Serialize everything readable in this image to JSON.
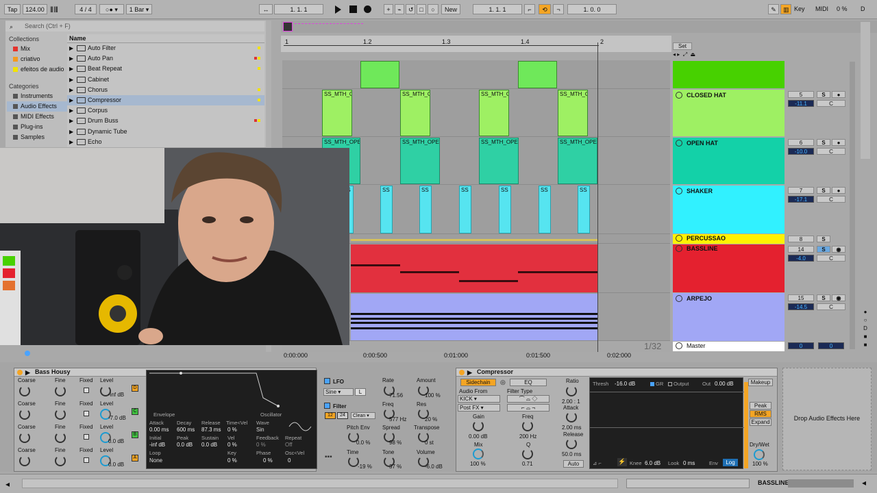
{
  "topbar": {
    "tap": "Tap",
    "tempo": "124.00",
    "sig_num": "4",
    "sig_den": "4",
    "quant": "1 Bar",
    "pos": "1.   1.   1",
    "new": "New",
    "loop_start": "1.   1.   1",
    "loop_len": "1.   0.   0",
    "key": "Key",
    "midi": "MIDI",
    "cpu": "0 %",
    "d": "D"
  },
  "browser": {
    "search_placeholder": "Search (Ctrl + F)",
    "collections_title": "Collections",
    "collections": [
      {
        "label": "Mix",
        "color": "#e4332c"
      },
      {
        "label": "criativo",
        "color": "#f39b1f"
      },
      {
        "label": "efeitos de audio",
        "color": "#f2e200"
      }
    ],
    "categories_title": "Categories",
    "categories": [
      "Instruments",
      "Audio Effects",
      "MIDI Effects",
      "Plug-ins",
      "Samples"
    ],
    "name_header": "Name",
    "files": [
      "Auto Filter",
      "Auto Pan",
      "Beat Repeat",
      "Cabinet",
      "Chorus",
      "Compressor",
      "Corpus",
      "Drum Buss",
      "Dynamic Tube",
      "Echo"
    ]
  },
  "arrangement": {
    "ruler": [
      "1",
      "1.2",
      "1.3",
      "1.4",
      "2"
    ],
    "set": "Set",
    "time_ruler": [
      "0:00:000",
      "0:00:500",
      "0:01:000",
      "0:01:500",
      "0:02:000"
    ],
    "grid": "1/32",
    "clip_a": "SS_MTH_C",
    "clip_b": "SS_MTH_OPE",
    "clip_c": "SS"
  },
  "tracks": [
    {
      "name": "",
      "color": "#47d100",
      "num": "",
      "vol": ""
    },
    {
      "name": "CLOSED HAT",
      "color": "#9ef063",
      "num": "5",
      "vol": "-11.1"
    },
    {
      "name": "OPEN HAT",
      "color": "#13d1a8",
      "num": "6",
      "vol": "-10.0"
    },
    {
      "name": "SHAKER",
      "color": "#31f1ff",
      "num": "7",
      "vol": "-17.1"
    },
    {
      "name": "PERCUSSAO",
      "color": "#fff200",
      "num": "8",
      "vol": ""
    },
    {
      "name": "BASSLINE",
      "color": "#e4212f",
      "num": "14",
      "vol": "-4.0"
    },
    {
      "name": "ARPEJO",
      "color": "#a1a7f5",
      "num": "15",
      "vol": "-14.5"
    },
    {
      "name": "Master",
      "color": "#ffffff",
      "num": "0",
      "vol": "0"
    }
  ],
  "mixer": {
    "s": "S",
    "c": "C"
  },
  "bass": {
    "title": "Bass Housy",
    "rows": [
      {
        "coarse": "Coarse",
        "fine": "Fine",
        "fixed": "Fixed",
        "level": "Level",
        "val": "-inf dB",
        "tag": "D"
      },
      {
        "coarse": "Coarse",
        "fine": "Fine",
        "fixed": "Fixed",
        "level": "Level",
        "val": "-7.0 dB",
        "tag": "C"
      },
      {
        "coarse": "Coarse",
        "fine": "Fine",
        "fixed": "Fixed",
        "level": "Level",
        "val": "0.0 dB",
        "tag": "B"
      },
      {
        "coarse": "Coarse",
        "fine": "Fine",
        "fixed": "Fixed",
        "level": "Level",
        "val": "0.0 dB",
        "tag": "A"
      }
    ]
  },
  "envelope": {
    "envelope": "Envelope",
    "oscillator": "Oscillator",
    "attack": "Attack",
    "decay": "Decay",
    "release": "Release",
    "timevel": "Time<Vel",
    "wave": "Wave",
    "attack_v": "0.00 ms",
    "decay_v": "600 ms",
    "release_v": "87.3 ms",
    "timevel_v": "0 %",
    "wave_v": "Sin",
    "initial": "Initial",
    "peak": "Peak",
    "sustain": "Sustain",
    "vel": "Vel",
    "feedback": "Feedback",
    "repeat": "Repeat",
    "initial_v": "-inf dB",
    "peak_v": "0.0 dB",
    "sustain_v": "0.0 dB",
    "vel_v": "0 %",
    "feedback_v": "0 %",
    "repeat_v": "Off",
    "loop": "Loop",
    "key": "Key",
    "phase": "Phase",
    "oscvel": "Osc<Vel",
    "loop_v": "None",
    "key_v": "0 %",
    "phase_v": "0 %",
    "oscvel_v": "0"
  },
  "lfo": {
    "lfo": "LFO",
    "wave": "Sine",
    "l": "L",
    "rate": "Rate",
    "rate_v": "71.56",
    "amount": "Amount",
    "amount_v": "100 %",
    "filter": "Filter",
    "mode": "Clean",
    "f12": "12",
    "f24": "24",
    "freq": "Freq",
    "freq_v": "577 Hz",
    "res": "Res",
    "res_v": "20 %",
    "pitchenv": "Pitch Env",
    "pitchenv_v": "0.0 %",
    "spread": "Spread",
    "spread_v": "98 %",
    "transpose": "Transpose",
    "transpose_v": "0 st",
    "time": "Time",
    "time_v": "-19 %",
    "tone": "Tone",
    "tone_v": "37 %",
    "volume": "Volume",
    "volume_v": "-6.0 dB"
  },
  "compressor": {
    "title": "Compressor",
    "sidechain": "Sidechain",
    "eq": "EQ",
    "audio_from": "Audio From",
    "source": "KICK",
    "post": "Post FX",
    "filter_type": "Filter Type",
    "gain": "Gain",
    "gain_v": "0.00 dB",
    "mix": "Mix",
    "mix_v": "100 %",
    "freq": "Freq",
    "freq_v": "200 Hz",
    "q": "Q",
    "q_v": "0.71",
    "ratio": "Ratio",
    "ratio_v": "2.00 : 1",
    "attack": "Attack",
    "attack_v": "2.00 ms",
    "release": "Release",
    "release_v": "50.0 ms",
    "auto": "Auto",
    "thresh": "Thresh",
    "thresh_v": "-16.0 dB",
    "gr": "GR",
    "output": "Output",
    "out": "Out",
    "out_v": "0.00 dB",
    "makeup": "Makeup",
    "peak": "Peak",
    "rms": "RMS",
    "expand": "Expand",
    "knee": "Knee",
    "knee_v": "6.0 dB",
    "look": "Look",
    "look_v": "0 ms",
    "envl": "Env",
    "log": "Log",
    "drywet": "Dry/Wet",
    "drywet_v": "100 %"
  },
  "drop": "Drop Audio Effects Here",
  "status": {
    "track": "BASSLINE"
  }
}
